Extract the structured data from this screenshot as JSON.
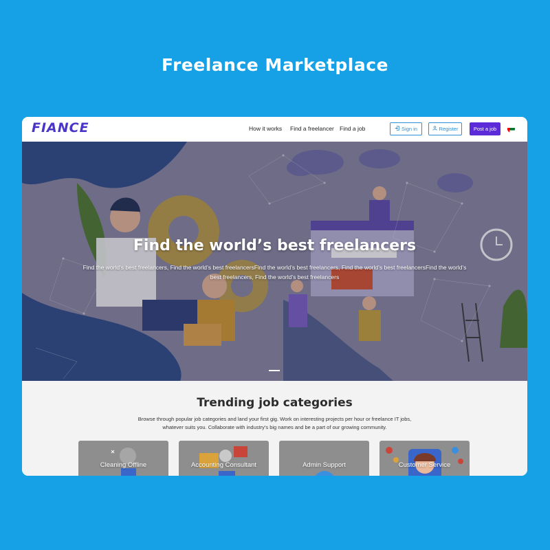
{
  "page": {
    "title": "Freelance Marketplace"
  },
  "navbar": {
    "logo": "FIANCE",
    "links": [
      "How it works",
      "Find a freelancer",
      "Find a job"
    ],
    "signin_label": "Sign in",
    "register_label": "Register",
    "post_job_label": "Post a job",
    "flag_icon": "uae-flag-icon"
  },
  "hero": {
    "title": "Find the world’s best freelancers",
    "subtitle": "Find the world’s best freelancers, Find the world’s best freelancersFind the world’s best freelancers, Find the world’s best freelancersFind the world’s best freelancers, Find the world’s best freelancers"
  },
  "categories": {
    "title": "Trending job categories",
    "description": "Browse through popular job categories and land your first gig. Work on interesting projects per hour or freelance IT jobs, whatever suits you. Collaborate with industry’s big names and be a part of our growing community.",
    "cards": [
      "Cleaning Offline",
      "Accounting Consultant",
      "Admin Support",
      "Customer Service"
    ]
  },
  "colors": {
    "background": "#16a0e6",
    "brand": "#4a35c9",
    "accent_purple": "#5b2bd9",
    "accent_blue": "#2b8fd8"
  }
}
